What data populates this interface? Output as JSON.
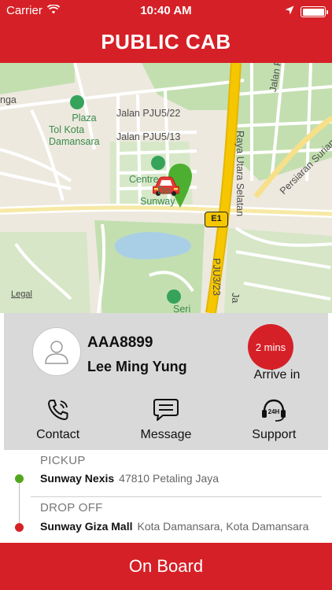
{
  "status_bar": {
    "carrier": "Carrier",
    "time": "10:40 AM"
  },
  "header": {
    "title": "PUBLIC CAB"
  },
  "map": {
    "labels": {
      "jalan_pju": "Jalan PJU",
      "raya_utara": "Raya Utara Selatan",
      "nga": "nga",
      "plaza_line1": "Plaza",
      "plaza_line2": "Tol Kota",
      "plaza_line3": "Damansara",
      "jalan_pju5_22": "Jalan PJU5/22",
      "jalan_pju5_13": "Jalan PJU5/13",
      "persiaran": "Persiaran Surian",
      "centre_line1": "Centre",
      "centre_line2": "Da",
      "centre_line3": "Sunway",
      "highway_shield": "E1",
      "pju3_23": "PJU3/23",
      "ja": "Ja",
      "seri": "Seri",
      "legal": "Legal"
    },
    "icons": [
      "location-arrow-icon",
      "map-pin-icon",
      "car-icon"
    ]
  },
  "driver": {
    "plate": "AAA8899",
    "name": "Lee Ming Yung",
    "eta": "2 mins",
    "eta_label": "Arrive in"
  },
  "actions": [
    {
      "label": "Contact",
      "icon": "phone-icon"
    },
    {
      "label": "Message",
      "icon": "chat-bubble-icon"
    },
    {
      "label": "Support",
      "icon": "24h-headset-icon"
    }
  ],
  "route": {
    "pickup": {
      "label": "PICKUP",
      "place": "Sunway Nexis",
      "address": "47810 Petaling Jaya"
    },
    "dropoff": {
      "label": "DROP OFF",
      "place": "Sunway Giza Mall",
      "address": "Kota Damansara, Kota Damansara"
    }
  },
  "bottom_button": {
    "label": "On Board"
  },
  "colors": {
    "brand_red": "#d62027",
    "card_grey": "#d9d9d9",
    "pickup_green": "#52a61d",
    "map_green": "#c3dfb0",
    "highway_yellow": "#f6c700",
    "water_blue": "#a9cfe6"
  }
}
